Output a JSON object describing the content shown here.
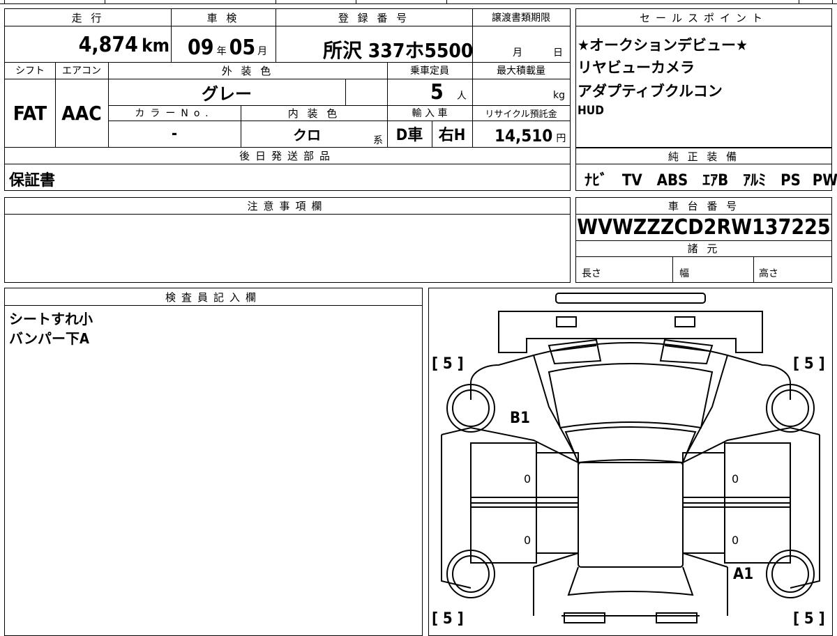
{
  "top": {
    "mileage": {
      "label": "走 行",
      "value": "4,874",
      "unit": "km"
    },
    "shaken": {
      "label": "車 検",
      "year": "09",
      "year_unit": "年",
      "month": "05",
      "month_unit": "月"
    },
    "registration": {
      "label": "登 録 番 号",
      "value": "所沢 337ホ5500"
    },
    "transfer_deadline": {
      "label": "譲渡書類期限",
      "month_unit": "月",
      "day_unit": "日"
    },
    "sales_points": {
      "label": "セールスポイント",
      "lines": [
        "★オークションデビュー★",
        "リヤビューカメラ",
        "アダプティブクルコン",
        "HUD"
      ]
    }
  },
  "row2": {
    "shift": {
      "label": "シフト",
      "value": "FAT"
    },
    "aircon": {
      "label": "エアコン",
      "value": "AAC"
    },
    "exterior_color": {
      "label": "外 装 色",
      "value": "グレー"
    },
    "capacity": {
      "label": "乗車定員",
      "value": "5",
      "unit": "人"
    },
    "max_load": {
      "label": "最大積載量",
      "unit": "kg"
    },
    "color_no": {
      "label": "カラーNo.",
      "value": "-"
    },
    "interior_color": {
      "label": "内 装 色",
      "value": "クロ",
      "suffix": "系"
    },
    "import": {
      "label": "輸 入 車",
      "value1": "D車",
      "value2": "右H"
    },
    "recycle": {
      "label": "リサイクル預託金",
      "value": "14,510",
      "unit": "円"
    }
  },
  "later_parts": {
    "label": "後日発送部品",
    "value": "保証書"
  },
  "equipment": {
    "label": "純 正 装 備",
    "items": [
      "ﾅﾋﾞ",
      "TV",
      "ABS",
      "ｴｱB",
      "ｱﾙﾐ",
      "PS",
      "PW"
    ]
  },
  "notes": {
    "label": "注意事項欄",
    "value": ""
  },
  "chassis": {
    "label": "車 台 番 号",
    "value": "WVWZZZCD2RW137225"
  },
  "specs": {
    "label": "諸 元",
    "length": "長さ",
    "width": "幅",
    "height": "高さ"
  },
  "inspector": {
    "label": "検査員記入欄",
    "lines": [
      "シートすれ小",
      "バンパー下A"
    ]
  },
  "diagram": {
    "tire_marks": [
      "[ 5 ]",
      "[ 5 ]",
      "[ 5 ]",
      "[ 5 ]"
    ],
    "damage": {
      "front_left": "B1",
      "rear_right": "A1"
    },
    "door_values": [
      "0",
      "0",
      "0",
      "0"
    ]
  }
}
